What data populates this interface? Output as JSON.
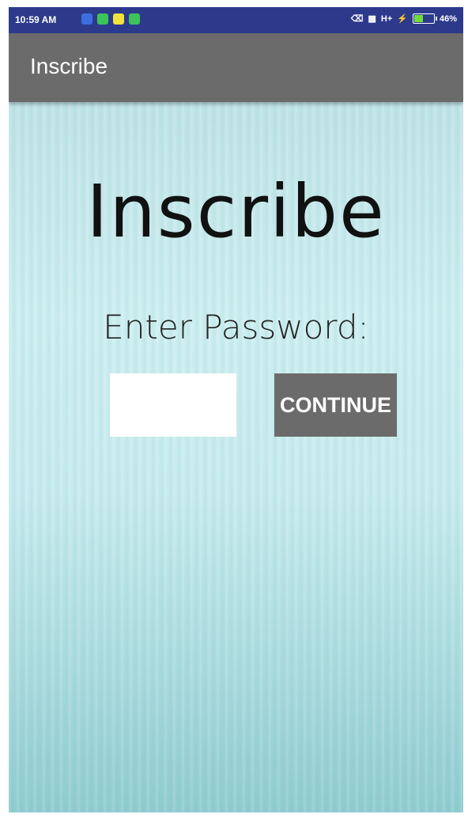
{
  "status_bar": {
    "time": "10:59 AM",
    "network": "H+",
    "battery": "46%",
    "battery_level": 0.46,
    "notification_icons": [
      {
        "name": "messenger-notification-icon",
        "color": "#3b6fe0"
      },
      {
        "name": "whatsapp-notification-icon",
        "color": "#3cc45a"
      },
      {
        "name": "snapchat-notification-icon",
        "color": "#f2e23a"
      },
      {
        "name": "app-notification-icon",
        "color": "#3cc45a"
      }
    ]
  },
  "app_bar": {
    "title": "Inscribe"
  },
  "main": {
    "hero_title": "Inscribe",
    "prompt": "Enter Password:",
    "password_value": "",
    "password_placeholder": "",
    "continue_label": "CONTINUE"
  },
  "colors": {
    "status_bar": "#2d3a8c",
    "app_bar": "#6b6b6b",
    "button": "#6b6b6b",
    "background_teal": "#c7ebee"
  }
}
